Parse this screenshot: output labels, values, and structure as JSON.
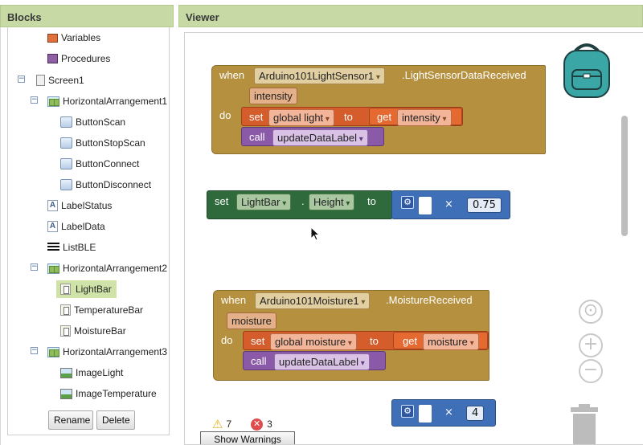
{
  "panels": {
    "blocks_title": "Blocks",
    "viewer_title": "Viewer"
  },
  "tree": {
    "items": [
      {
        "label": "Variables",
        "icon": "variables-icon"
      },
      {
        "label": "Procedures",
        "icon": "procedures-icon"
      },
      {
        "label": "Screen1",
        "icon": "screen-icon",
        "expander": "−"
      },
      {
        "label": "HorizontalArrangement1",
        "icon": "horizontal-arrangement-icon",
        "expander": "−"
      },
      {
        "label": "ButtonScan",
        "icon": "button-icon"
      },
      {
        "label": "ButtonStopScan",
        "icon": "button-icon"
      },
      {
        "label": "ButtonConnect",
        "icon": "button-icon"
      },
      {
        "label": "ButtonDisconnect",
        "icon": "button-icon"
      },
      {
        "label": "LabelStatus",
        "icon": "label-icon"
      },
      {
        "label": "LabelData",
        "icon": "label-icon"
      },
      {
        "label": "ListBLE",
        "icon": "list-icon"
      },
      {
        "label": "HorizontalArrangement2",
        "icon": "horizontal-arrangement-icon",
        "expander": "−"
      },
      {
        "label": "LightBar",
        "icon": "bar-icon",
        "selected": true
      },
      {
        "label": "TemperatureBar",
        "icon": "bar-icon"
      },
      {
        "label": "MoistureBar",
        "icon": "bar-icon"
      },
      {
        "label": "HorizontalArrangement3",
        "icon": "horizontal-arrangement-icon",
        "expander": "−"
      },
      {
        "label": "ImageLight",
        "icon": "image-icon"
      },
      {
        "label": "ImageTemperature",
        "icon": "image-icon"
      }
    ],
    "rename_label": "Rename",
    "delete_label": "Delete",
    "label_icon_glyph": "A"
  },
  "blocks": {
    "event1": {
      "when": "when",
      "component": "Arduino101LightSensor1",
      "event": ".LightSensorDataReceived",
      "param": "intensity",
      "do": "do",
      "set": "set",
      "set_var": "global light",
      "to": "to",
      "get": "get",
      "get_var": "intensity",
      "call": "call",
      "proc": "updateDataLabel"
    },
    "setter": {
      "set": "set",
      "component": "LightBar",
      "dot": ".",
      "property": "Height",
      "to": "to",
      "times": "×",
      "value": "0.75"
    },
    "event2": {
      "when": "when",
      "component": "Arduino101Moisture1",
      "event": ".MoistureReceived",
      "param": "moisture",
      "do": "do",
      "set": "set",
      "set_var": "global moisture",
      "to": "to",
      "get": "get",
      "get_var": "moisture",
      "call": "call",
      "proc": "updateDataLabel"
    },
    "loose_math": {
      "times": "×",
      "value": "4"
    }
  },
  "warnings": {
    "warning_count": "7",
    "error_count": "3",
    "show_warnings_label": "Show Warnings"
  },
  "controls": {
    "center_glyph": "⊙",
    "zoom_in_glyph": "+",
    "zoom_out_glyph": "−"
  },
  "colors": {
    "event": "#b5903f",
    "variable": "#d55c2b",
    "procedure": "#8a5aa8",
    "setter": "#2e6a3c",
    "math": "#3f6fb6",
    "header": "#c7d9a4"
  }
}
